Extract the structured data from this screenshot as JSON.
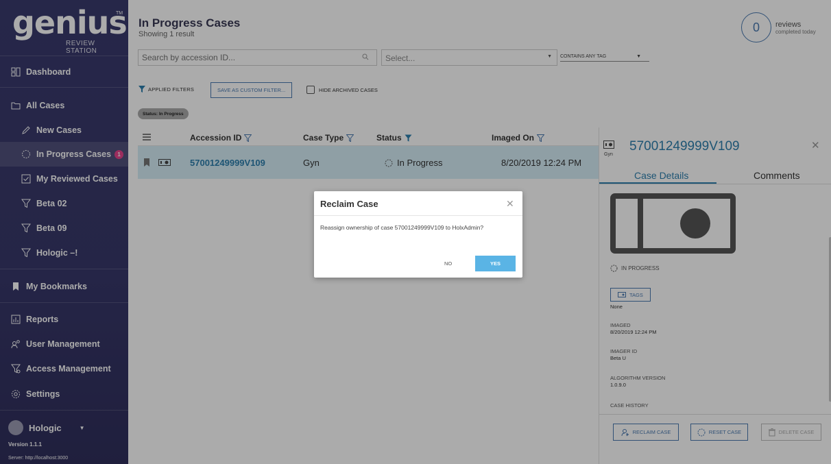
{
  "brand": {
    "word": "genius",
    "tm": "TM",
    "sub": "REVIEW STATION"
  },
  "nav": {
    "dashboard": "Dashboard",
    "all_cases": "All Cases",
    "new_cases": "New Cases",
    "in_progress": "In Progress Cases",
    "in_progress_count": "1",
    "my_reviewed": "My Reviewed Cases",
    "beta02": "Beta 02",
    "beta09": "Beta 09",
    "hologic_filter": "Hologic –!",
    "bookmarks": "My Bookmarks",
    "reports": "Reports",
    "user_mgmt": "User Management",
    "access_mgmt": "Access Management",
    "settings": "Settings"
  },
  "user": {
    "name": "Hologic",
    "version": "Version 1.1.1",
    "server": "Server: http://localhost:3000"
  },
  "header": {
    "title": "In Progress Cases",
    "subtitle": "Showing 1 result",
    "reviews_count": "0",
    "reviews_label": "reviews",
    "reviews_sub": "completed today"
  },
  "filters": {
    "search_placeholder": "Search by accession ID...",
    "select_placeholder": "Select...",
    "tag_mode": "CONTAINS ANY TAG",
    "applied_label": "APPLIED FILTERS",
    "save_label": "SAVE AS CUSTOM FILTER...",
    "hide_label": "HIDE ARCHIVED CASES",
    "chip": "Status: In Progress"
  },
  "table": {
    "columns": [
      "Accession ID",
      "Case Type",
      "Status",
      "Imaged On"
    ],
    "rows": [
      {
        "accession": "57001249999V109",
        "case_type": "Gyn",
        "status": "In Progress",
        "imaged_on": "8/20/2019 12:24 PM"
      }
    ]
  },
  "panel": {
    "case_id": "57001249999V109",
    "case_type": "Gyn",
    "tabs": [
      "Case Details",
      "Comments"
    ],
    "status": "IN PROGRESS",
    "tags_label": "TAGS",
    "tags_value": "None",
    "imaged_label": "IMAGED",
    "imaged_value": "8/20/2019 12:24 PM",
    "imager_label": "IMAGER ID",
    "imager_value": "Beta U",
    "algo_label": "ALGORITHM VERSION",
    "algo_value": "1.0.9.0",
    "history_label": "CASE HISTORY",
    "reclaim": "RECLAIM CASE",
    "reset": "RESET CASE",
    "delete": "DELETE CASE"
  },
  "modal": {
    "title": "Reclaim Case",
    "body": "Reassign ownership of case 57001249999V109 to HolxAdmin?",
    "no": "NO",
    "yes": "YES"
  },
  "colors": {
    "sidebar": "#3a3b6e",
    "accent": "#2e7fae",
    "badge": "#e8438c",
    "row_highlight": "#d6edf7",
    "yes_button": "#5ab4e5"
  }
}
